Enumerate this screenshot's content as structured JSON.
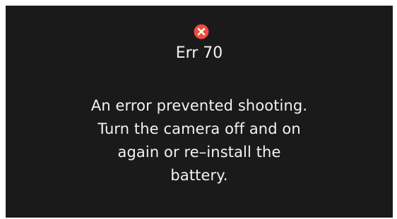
{
  "dialog": {
    "icon": "error-x-icon",
    "icon_color": "#f04a3c",
    "error_code": "Err 70",
    "message_lines": [
      "An error prevented shooting.",
      "Turn the camera off and on",
      "again or re–install the",
      "battery."
    ]
  },
  "colors": {
    "screen_background": "#1a1a1a",
    "text": "#f2f2f2"
  }
}
